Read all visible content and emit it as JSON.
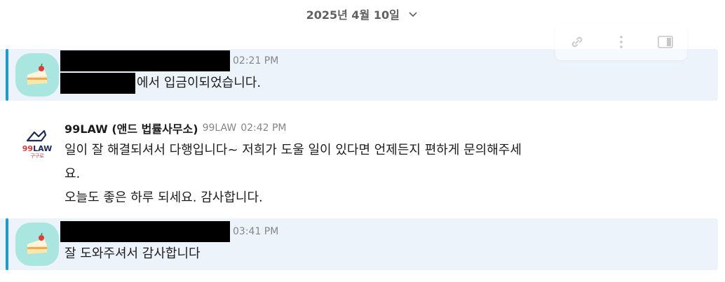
{
  "date_divider": {
    "label": "2025년 4월 10일"
  },
  "messages": [
    {
      "time": "02:21 PM",
      "body_suffix": "에서 입금이되었습니다.",
      "avatar": "cake-icon"
    },
    {
      "sender": "99LAW (앤드 법률사무소)",
      "app_tag": "99LAW",
      "time": "02:42 PM",
      "lines": [
        "일이 잘 해결되셔서 다행입니다~ 저희가 도울 일이 있다면 언제든지 편하게 문의해주세",
        "요.",
        "오늘도 좋은 하루 되세요. 감사합니다."
      ],
      "avatar": "99law-logo",
      "logo_text": "99LAW",
      "logo_sub": "구구로"
    },
    {
      "time": "03:41 PM",
      "body": "잘 도와주셔서 감사합니다",
      "avatar": "cake-icon"
    }
  ],
  "colors": {
    "highlight_bg": "#edf3fb",
    "highlight_bar": "#1d9bd1",
    "avatar_bg": "#a8e6df",
    "logo_navy": "#1e2a5a",
    "logo_red": "#d93a3a"
  }
}
